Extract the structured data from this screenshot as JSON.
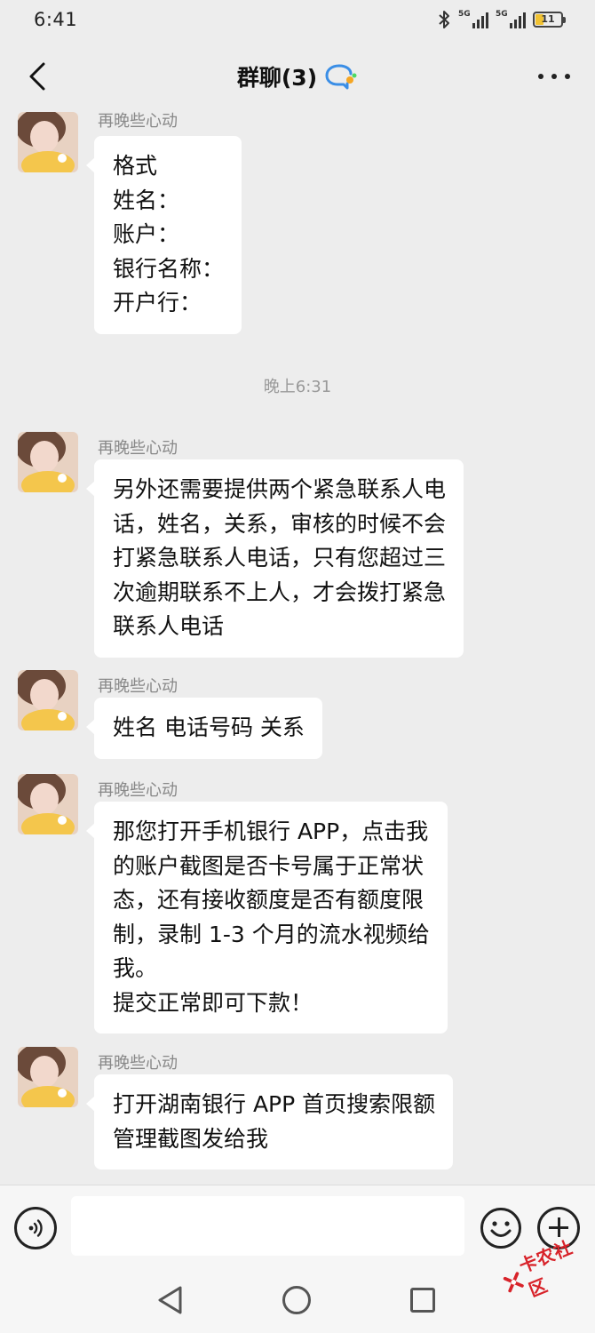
{
  "status_bar": {
    "time": "6:41",
    "bluetooth_icon": "bluetooth-icon",
    "signal_1_label": "5G",
    "signal_2_label": "5G",
    "battery_level": "11"
  },
  "nav": {
    "title": "群聊(3)",
    "back_icon": "chevron-left-icon",
    "more_icon": "more-dots-icon",
    "badge_icon": "group-chat-badge-icon"
  },
  "messages": [
    {
      "sender": "再晚些心动",
      "lines": [
        "格式",
        "姓名：",
        "账户：",
        "银行名称：",
        "开户行："
      ]
    },
    {
      "sender": "再晚些心动",
      "lines": [
        "另外还需要提供两个紧急联系人电",
        "话，姓名，关系，审核的时候不会",
        "打紧急联系人电话，只有您超过三",
        "次逾期联系不上人，才会拨打紧急",
        "联系人电话"
      ]
    },
    {
      "sender": "再晚些心动",
      "lines": [
        "姓名 电话号码 关系"
      ]
    },
    {
      "sender": "再晚些心动",
      "lines": [
        "那您打开手机银行 APP，点击我",
        "的账户截图是否卡号属于正常状",
        "态，还有接收额度是否有额度限",
        "制，录制 1-3 个月的流水视频给",
        "我。",
        "提交正常即可下款！"
      ]
    },
    {
      "sender": "再晚些心动",
      "lines": [
        "打开湖南银行 APP 首页搜索限额",
        "管理截图发给我"
      ]
    }
  ],
  "time_separator": "晚上6:31",
  "input_bar": {
    "voice_icon": "voice-icon",
    "input_value": "",
    "emoji_icon": "emoji-icon",
    "plus_icon": "plus-icon"
  },
  "system_nav": {
    "back_icon": "triangle-back-icon",
    "home_icon": "circle-home-icon",
    "recent_icon": "square-recent-icon"
  },
  "watermark": "卡农社区",
  "colors": {
    "background": "#ededed",
    "bubble": "#ffffff",
    "watermark": "#d8232a"
  }
}
